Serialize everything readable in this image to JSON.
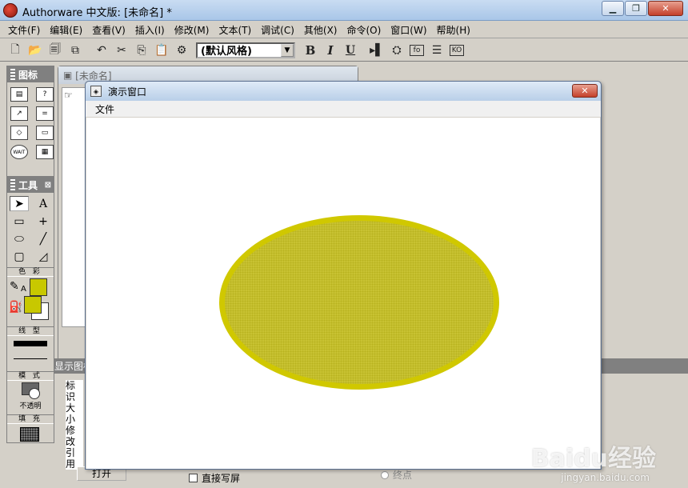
{
  "window": {
    "title": "Authorware 中文版: [未命名] *"
  },
  "menubar": [
    "文件(F)",
    "编辑(E)",
    "查看(V)",
    "插入(I)",
    "修改(M)",
    "文本(T)",
    "调试(C)",
    "其他(X)",
    "命令(O)",
    "窗口(W)",
    "帮助(H)"
  ],
  "toolbar": {
    "style_value": "(默认风格)",
    "bold": "B",
    "italic": "I",
    "underline": "U",
    "fo_label": "fo",
    "ko_label": "KO"
  },
  "palette": {
    "title": "图标",
    "wait_label": "WAIT"
  },
  "tools": {
    "title": "工具",
    "text_tool": "A",
    "color_label": "色 彩",
    "color_text_sample": "A",
    "line_label": "线 型",
    "mode_label": "模 式",
    "mode_value": "不透明",
    "fill_label": "填 充",
    "fill_color": "#c8c800",
    "stroke_color": "#c8c800"
  },
  "flowline": {
    "title": "[未命名]"
  },
  "properties": {
    "title": "显示图标",
    "labels": [
      "标识",
      "大小",
      "修改",
      "引用"
    ],
    "open_button": "打开",
    "direct_write_label": "直接写屏",
    "endpoint_label": "终点"
  },
  "presentation": {
    "title": "演示窗口",
    "menu_file": "文件",
    "ellipse_fill": "#c8c232",
    "ellipse_border": "#d0c800"
  },
  "watermark": {
    "text": "Baidu经验",
    "sub": "jingyan.baidu.com"
  }
}
